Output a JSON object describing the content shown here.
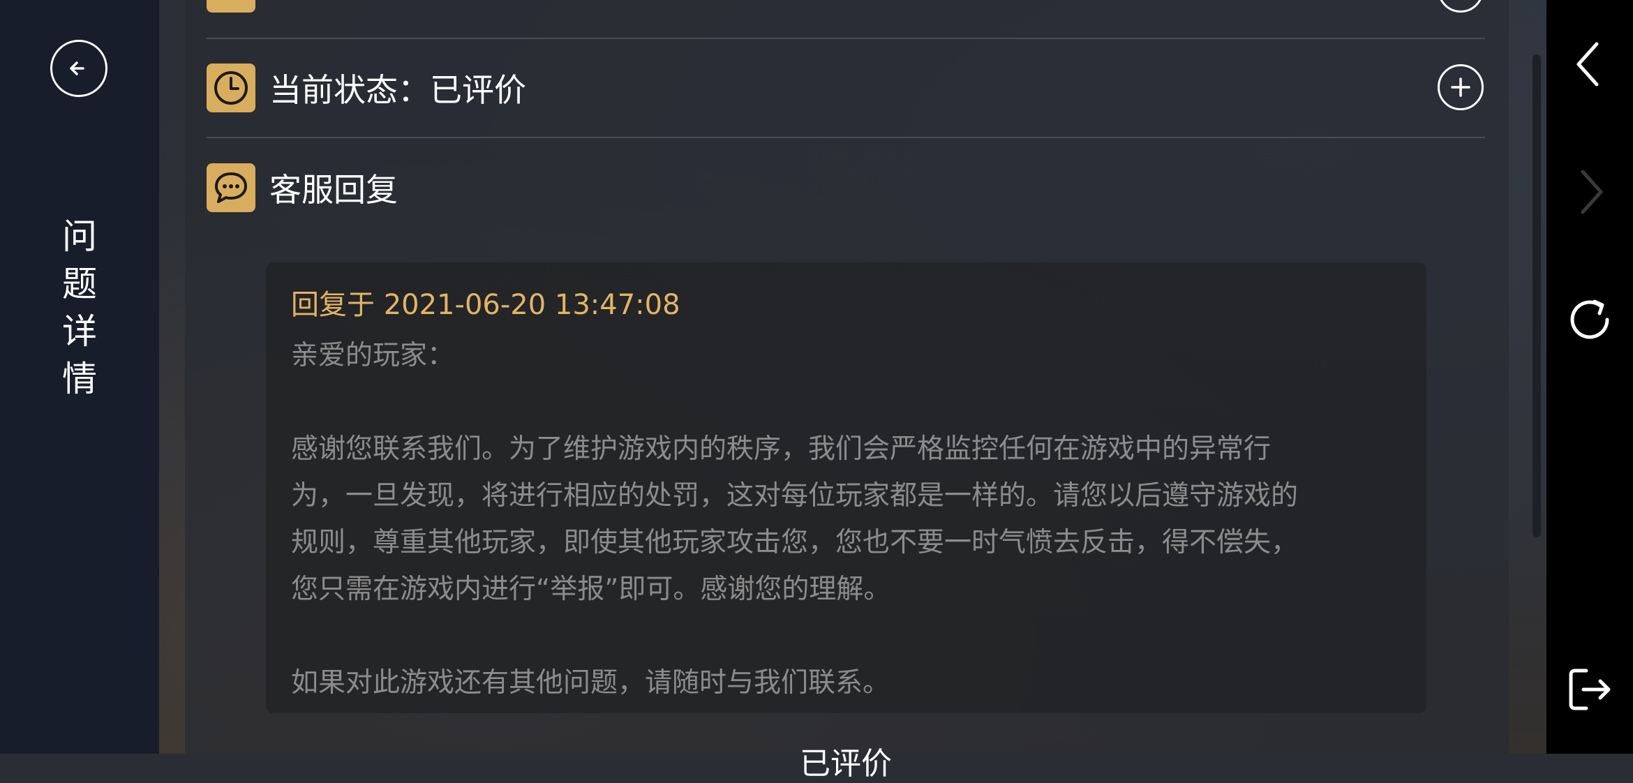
{
  "page": {
    "title_chars": [
      "问",
      "题",
      "详",
      "情"
    ]
  },
  "status_row": {
    "label": "当前状态：已评价"
  },
  "service_section": {
    "label": "客服回复"
  },
  "reply": {
    "timestamp": "回复于 2021-06-20 13:47:08",
    "greeting": "亲爱的玩家：",
    "line1": "感谢您联系我们。为了维护游戏内的秩序，我们会严格监控任何在游戏中的异常行",
    "line2": "为，一旦发现，将进行相应的处罚，这对每位玩家都是一样的。请您以后遵守游戏的",
    "line3": "规则，尊重其他玩家，即使其他玩家攻击您，您也不要一时气愤去反击，得不偿失，",
    "line4": "您只需在游戏内进行“举报”即可。感谢您的理解。",
    "closing": "如果对此游戏还有其他问题，请随时与我们联系。"
  },
  "bottom": {
    "label": "已评价"
  },
  "colors": {
    "accent_gold": "#d9ad5e",
    "timestamp_gold": "#e3b466",
    "left_panel": "#171d2b"
  },
  "icons": {
    "back": "arrow-left-circle-icon",
    "status": "clock-icon",
    "service": "chat-bubble-icon",
    "expand": "plus-circle-icon",
    "nav_back": "chevron-left-icon",
    "nav_forward": "chevron-right-icon",
    "nav_refresh": "refresh-icon",
    "nav_exit": "exit-icon"
  }
}
